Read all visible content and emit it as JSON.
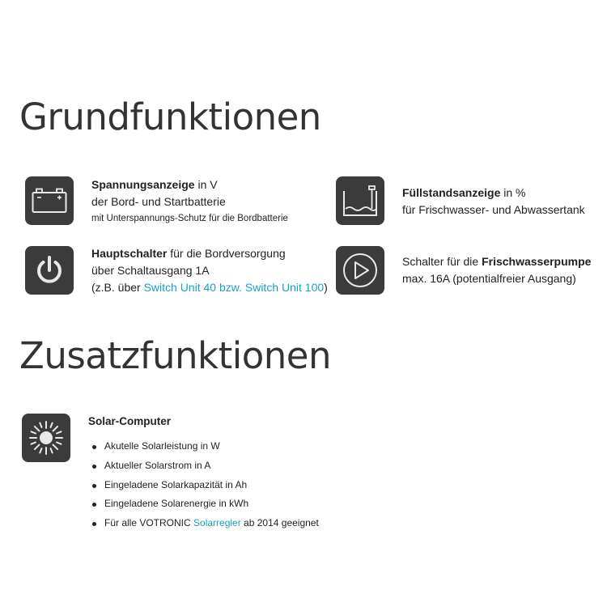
{
  "sections": {
    "basic_title": "Grundfunktionen",
    "extra_title": "Zusatzfunktionen"
  },
  "features": {
    "voltage": {
      "icon": "battery-icon",
      "bold": "Spannungsanzeige",
      "rest": " in V",
      "line2": "der Bord- und Startbatterie",
      "line3": "mit Unterspannungs-Schutz für die Bordbatterie"
    },
    "level": {
      "icon": "tank-level-icon",
      "bold": "Füllstandsanzeige",
      "rest": " in %",
      "line2": "für Frischwasser- und Abwassertank"
    },
    "main_switch": {
      "icon": "power-icon",
      "bold": "Hauptschalter",
      "rest": " für die Bordversorgung",
      "line2": "über Schaltausgang 1A",
      "line3_pre": "(z.B. über ",
      "line3_link": "Switch Unit 40 bzw. Switch Unit 100",
      "line3_post": ")"
    },
    "pump": {
      "icon": "play-icon",
      "pre": "Schalter für die ",
      "bold": "Frischwasserpumpe",
      "line2": "max. 16A (potentialfreier Ausgang)"
    }
  },
  "solar": {
    "icon": "sun-icon",
    "title": "Solar-Computer",
    "bullets": [
      "Akutelle Solarleistung in W",
      "Aktueller Solarstrom in A",
      "Eingeladene Solarkapazität in Ah",
      "Eingeladene Solarenergie in kWh"
    ],
    "last_pre": "Für alle VOTRONIC ",
    "last_link": "Solarregler",
    "last_post": " ab 2014 geeignet"
  },
  "colors": {
    "icon_bg": "#3b3b3b",
    "link": "#1a9fc4",
    "heading": "#333333"
  }
}
